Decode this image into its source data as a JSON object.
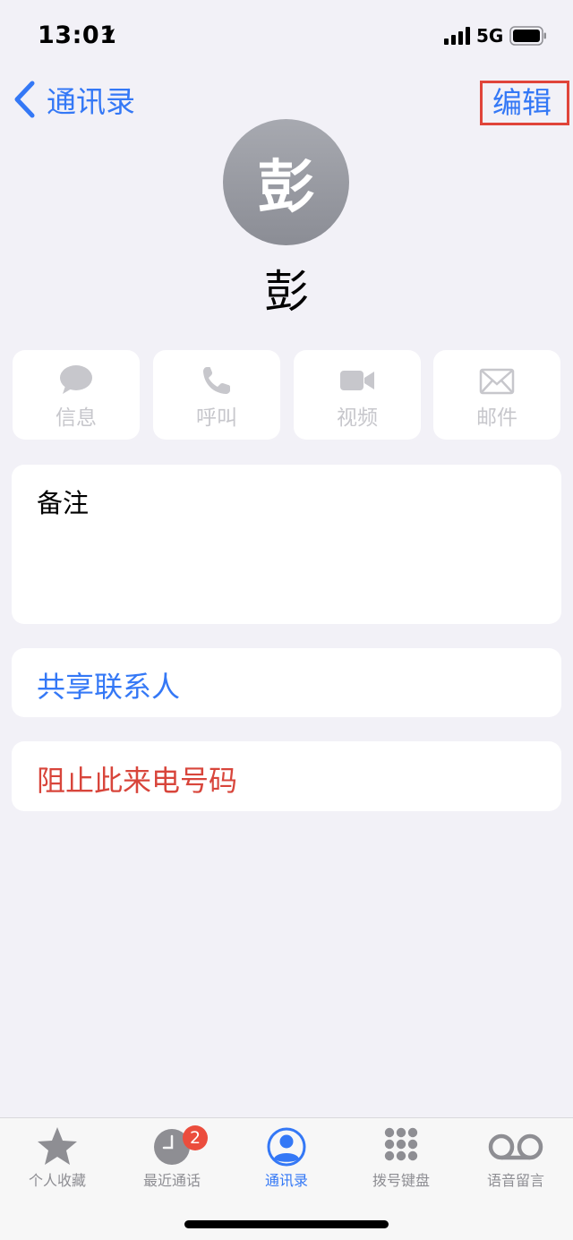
{
  "status_bar": {
    "time": "13:01",
    "network": "5G"
  },
  "nav": {
    "back_label": "通讯录",
    "edit_label": "编辑",
    "edit_highlight_color": "#e0443a"
  },
  "contact": {
    "initial": "彭",
    "name": "彭"
  },
  "actions": [
    {
      "label": "信息",
      "icon": "message-icon"
    },
    {
      "label": "呼叫",
      "icon": "phone-icon"
    },
    {
      "label": "视频",
      "icon": "video-icon"
    },
    {
      "label": "邮件",
      "icon": "mail-icon"
    }
  ],
  "notes": {
    "label": "备注"
  },
  "share_contact": {
    "label": "共享联系人"
  },
  "block_number": {
    "label": "阻止此来电号码"
  },
  "tab_bar": {
    "tabs": [
      {
        "label": "个人收藏",
        "icon": "star-icon",
        "active": false
      },
      {
        "label": "最近通话",
        "icon": "clock-icon",
        "active": false,
        "badge": "2"
      },
      {
        "label": "通讯录",
        "icon": "person-circle-icon",
        "active": true
      },
      {
        "label": "拨号键盘",
        "icon": "keypad-icon",
        "active": false
      },
      {
        "label": "语音留言",
        "icon": "voicemail-icon",
        "active": false
      }
    ]
  },
  "colors": {
    "accent": "#3478f6",
    "destructive": "#d8453b",
    "background": "#f2f1f7",
    "disabled": "#c7c7cc",
    "badge": "#eb4d3d"
  }
}
